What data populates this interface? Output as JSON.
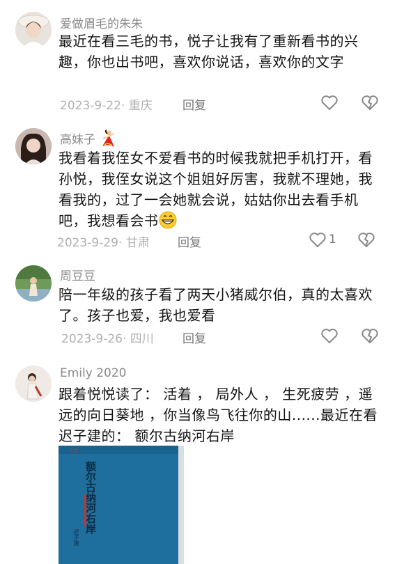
{
  "comments": [
    {
      "username": "爱做眉毛的朱朱",
      "text": "最近在看三毛的书，悦子让我有了重新看书的兴趣，你也出书吧，喜欢你说话，喜欢你的文字",
      "date_location": "2023-9-22· 重庆",
      "reply_label": "回复",
      "like_count": ""
    },
    {
      "username": "高妹子",
      "username_emoji": "flamenco-dancer-emoji",
      "text": "我看着我侄女不爱看书的时候我就把手机打开，看孙悦，我侄女说这个姐姐好厉害，我就不理她，我看我的，过了一会她就会说，姑姑你出去看手机吧，我想看会书",
      "text_emoji": "grinning-face-emoji",
      "date_location": "2023-9-29· 甘肃",
      "reply_label": "回复",
      "like_count": "1"
    },
    {
      "username": "周豆豆",
      "text": "陪一年级的孩子看了两天小猪威尔伯，真的太喜欢了。孩子也爱，我也爱看",
      "date_location": "2023-9-26· 四川",
      "reply_label": "回复",
      "like_count": ""
    },
    {
      "username": "Emily 2020",
      "text": "跟着悦悦读了： 活着 ， 局外人 ， 生死疲劳 ，遥远的向日葵地 ，你当像鸟飞往你的山......最近在看迟子建的： 额尔古纳河右岸",
      "book_title": "额尔古纳河右岸",
      "book_author": "迟子建"
    }
  ],
  "colors": {
    "username": "#8a8a8a",
    "meta": "#b0b0b0",
    "icon": "#8a8a8a",
    "book_cover": "#1f6f9e"
  }
}
